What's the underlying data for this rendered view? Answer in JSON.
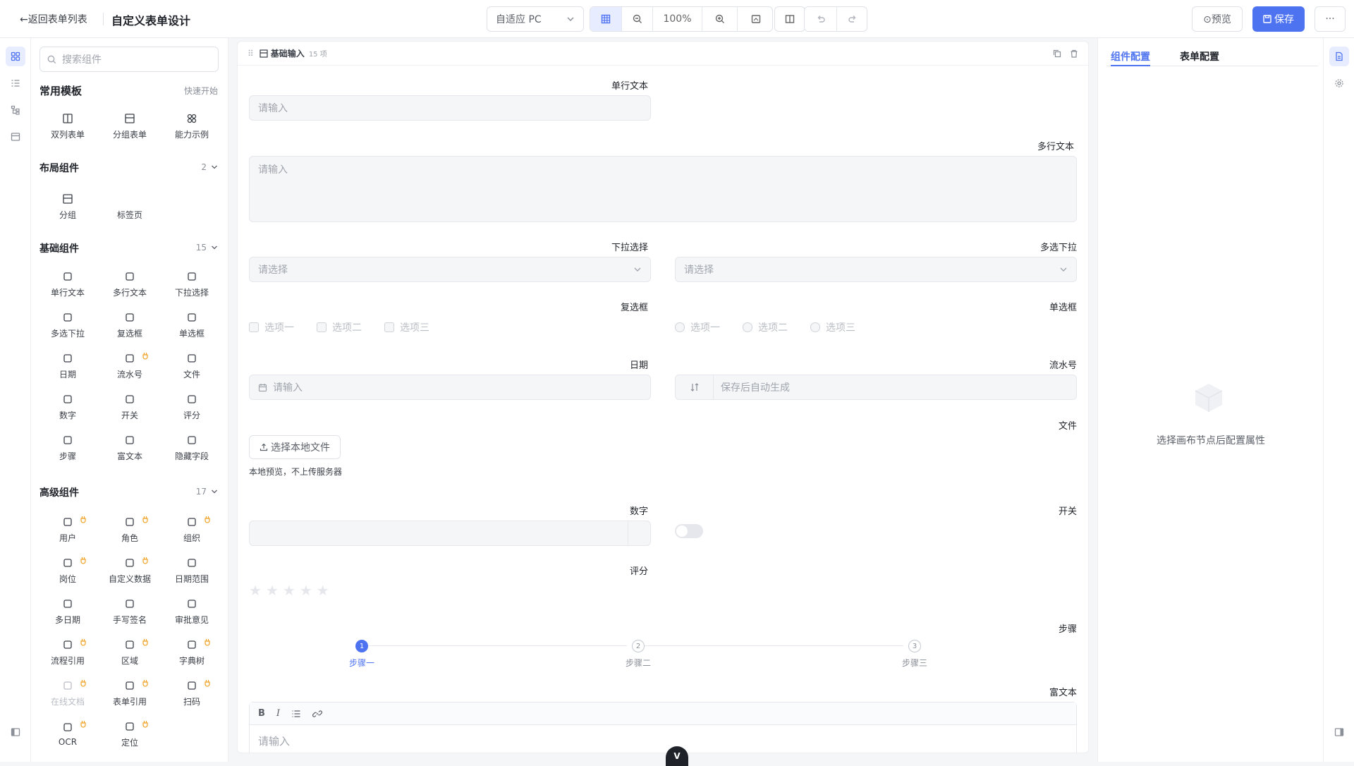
{
  "header": {
    "back_label": "←返回表单列表",
    "title": "自定义表单设计",
    "device_select": "自适应 PC",
    "zoom": "100%",
    "preview_label": "⊙预览",
    "save_label": "保存",
    "more_label": "···"
  },
  "left": {
    "search_placeholder": "搜索组件",
    "templates": {
      "title": "常用模板",
      "quick_start": "快速开始",
      "items": [
        "双列表单",
        "分组表单",
        "能力示例"
      ]
    },
    "layout": {
      "title": "布局组件",
      "count": "2",
      "items": [
        "分组",
        "标签页"
      ]
    },
    "basic": {
      "title": "基础组件",
      "count": "15",
      "items": [
        "单行文本",
        "多行文本",
        "下拉选择",
        "多选下拉",
        "复选框",
        "单选框",
        "日期",
        "流水号",
        "文件",
        "数字",
        "开关",
        "评分",
        "步骤",
        "富文本",
        "隐藏字段"
      ]
    },
    "advanced": {
      "title": "高级组件",
      "count": "17",
      "items": [
        "用户",
        "角色",
        "组织",
        "岗位",
        "自定义数据",
        "日期范围",
        "多日期",
        "手写签名",
        "审批意见",
        "流程引用",
        "区域",
        "字典树",
        "在线文档",
        "表单引用",
        "扫码",
        "OCR",
        "定位"
      ]
    }
  },
  "canvas": {
    "group_title": "基础输入",
    "group_count": "15 项",
    "fields": {
      "single_text": {
        "label": "单行文本",
        "placeholder": "请输入"
      },
      "multi_text": {
        "label": "多行文本",
        "placeholder": "请输入"
      },
      "dropdown": {
        "label": "下拉选择",
        "placeholder": "请选择"
      },
      "multi_dropdown": {
        "label": "多选下拉",
        "placeholder": "请选择"
      },
      "checkbox": {
        "label": "复选框",
        "options": [
          "选项一",
          "选项二",
          "选项三"
        ]
      },
      "radio": {
        "label": "单选框",
        "options": [
          "选项一",
          "选项二",
          "选项三"
        ]
      },
      "date": {
        "label": "日期",
        "placeholder": "请输入"
      },
      "serial": {
        "label": "流水号",
        "placeholder": "保存后自动生成"
      },
      "file": {
        "label": "文件",
        "button": "选择本地文件",
        "hint": "本地预览，不上传服务器"
      },
      "number": {
        "label": "数字"
      },
      "switch": {
        "label": "开关"
      },
      "rating": {
        "label": "评分",
        "value": 0,
        "max": 5
      },
      "steps": {
        "label": "步骤",
        "items": [
          {
            "num": "1",
            "label": "步骤一"
          },
          {
            "num": "2",
            "label": "步骤二"
          },
          {
            "num": "3",
            "label": "步骤三"
          }
        ],
        "current": 1
      },
      "richtext": {
        "label": "富文本",
        "placeholder": "请输入",
        "tools": [
          "B",
          "I"
        ]
      }
    },
    "floating_badge": "V"
  },
  "right": {
    "tabs": [
      "组件配置",
      "表单配置"
    ],
    "empty_text": "选择画布节点后配置属性"
  },
  "colors": {
    "accent": "#4e73f0",
    "badge": "#f0a020"
  }
}
